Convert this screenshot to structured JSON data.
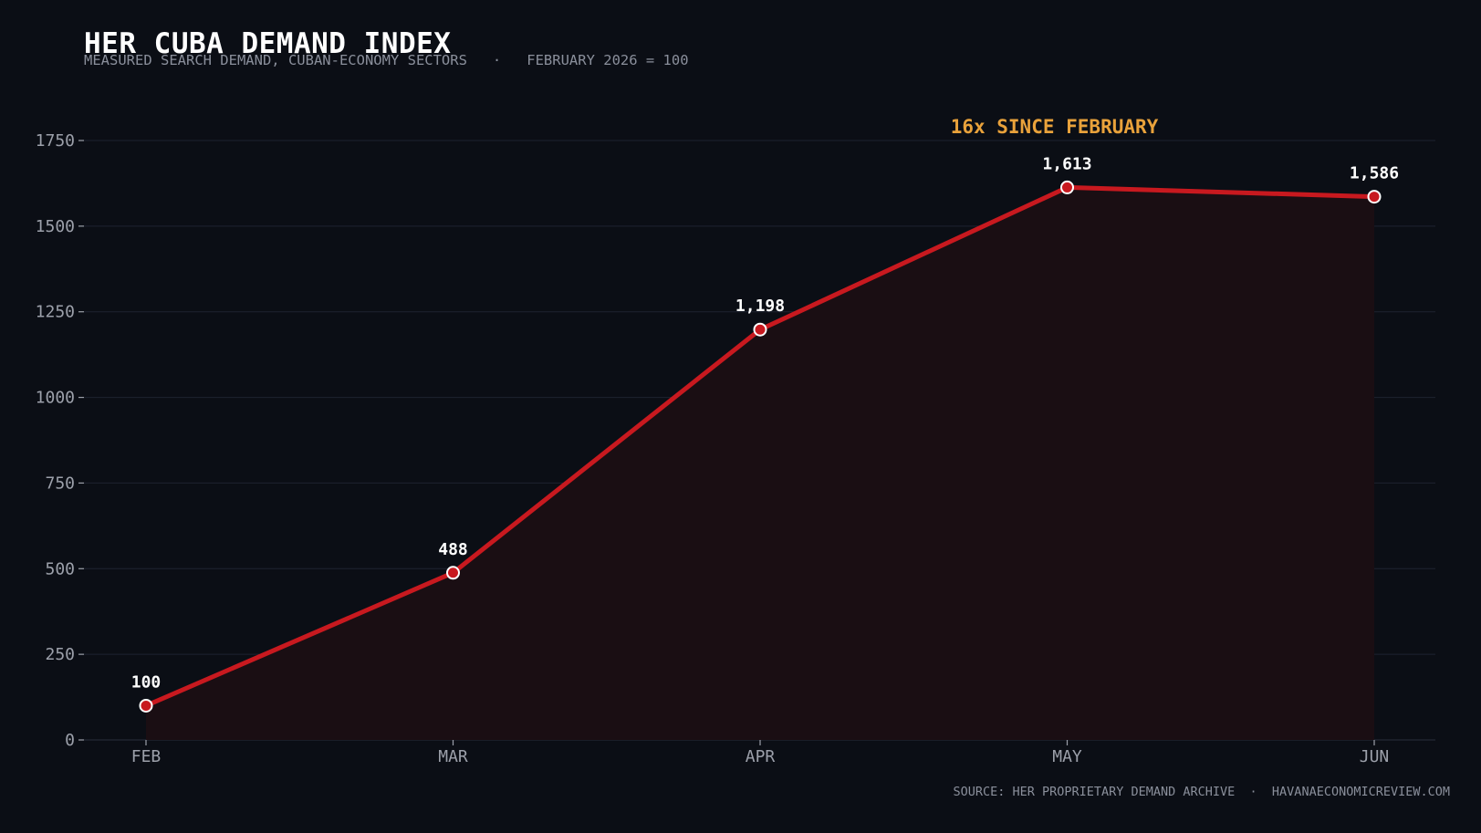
{
  "header": {
    "title": "HER CUBA DEMAND INDEX",
    "subtitle": "MEASURED SEARCH DEMAND, CUBAN-ECONOMY SECTORS   ·   FEBRUARY 2026 = 100"
  },
  "footer": {
    "source": "SOURCE: HER PROPRIETARY DEMAND ARCHIVE  ·  HAVANAECONOMICREVIEW.COM"
  },
  "colors": {
    "background": "#0b0e15",
    "line": "#c8191f",
    "area": "#1a0e13",
    "annotation": "#e9a23b",
    "grid": "#1e2330"
  },
  "chart_data": {
    "type": "line",
    "title": "HER CUBA DEMAND INDEX",
    "subtitle": "MEASURED SEARCH DEMAND, CUBAN-ECONOMY SECTORS · FEBRUARY 2026 = 100",
    "categories": [
      "FEB",
      "MAR",
      "APR",
      "MAY",
      "JUN"
    ],
    "series": [
      {
        "values": [
          100,
          488,
          1198,
          1613,
          1586
        ],
        "labels": [
          "100",
          "488",
          "1,198",
          "1,613",
          "1,586"
        ]
      }
    ],
    "yticks": [
      0,
      250,
      500,
      750,
      1000,
      1250,
      1500,
      1750
    ],
    "ylim": [
      0,
      1750
    ],
    "xlabel": "",
    "ylabel": "",
    "grid": true,
    "legend": "none",
    "annotation": {
      "text": "16x SINCE FEBRUARY",
      "category": "MAY",
      "value": 1750
    }
  }
}
